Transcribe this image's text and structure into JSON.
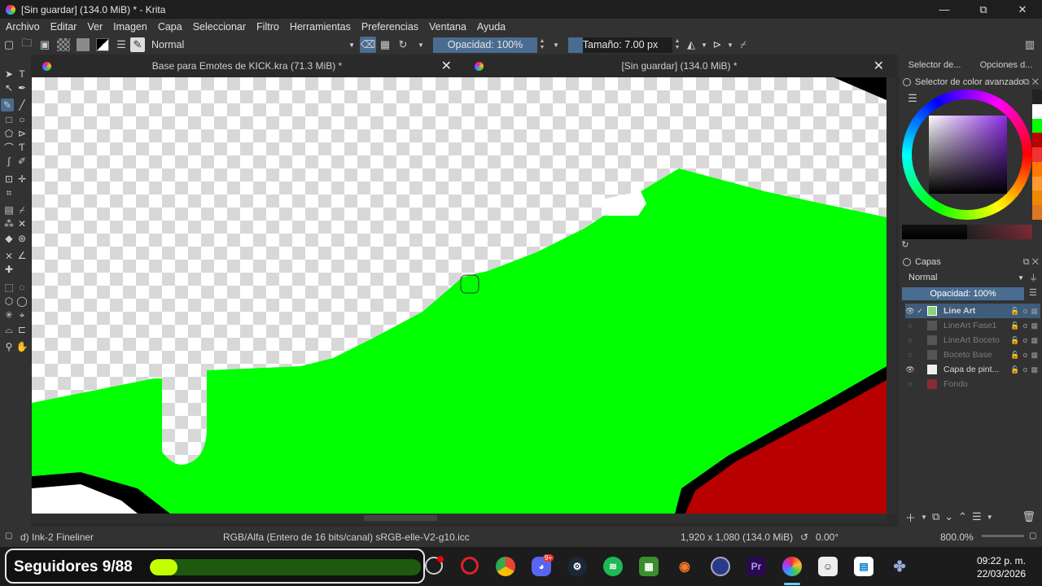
{
  "window": {
    "title": "[Sin guardar]  (134.0 MiB) * - Krita",
    "minimize": "—",
    "maximize": "⧉",
    "close": "✕"
  },
  "menu": [
    "Archivo",
    "Editar",
    "Ver",
    "Imagen",
    "Capa",
    "Seleccionar",
    "Filtro",
    "Herramientas",
    "Preferencias",
    "Ventana",
    "Ayuda"
  ],
  "toolbar": {
    "blend_mode": "Normal",
    "opacity": "Opacidad: 100%",
    "opacity_value": 100,
    "size": "Tamaño: 7.00 px"
  },
  "documents": [
    {
      "title": "Base para Emotes de KICK.kra (71.3 MiB) *",
      "close": "✕"
    },
    {
      "title": "[Sin guardar]  (134.0 MiB) *",
      "close": "✕"
    }
  ],
  "dock": {
    "tab_selector": "Selector de...",
    "tab_options": "Opciones d...",
    "color_panel_title": "Selector de color avanzado",
    "layers_title": "Capas",
    "layer_blend": "Normal",
    "layer_opacity": "Opacidad: 100%",
    "layers": [
      {
        "name": "Line Art",
        "visible": true,
        "selected": true
      },
      {
        "name": "LineArt Fase1",
        "visible": false,
        "selected": false
      },
      {
        "name": "LineArt Boceto",
        "visible": false,
        "selected": false
      },
      {
        "name": "Boceto Base",
        "visible": false,
        "selected": false
      },
      {
        "name": "Capa de pint...",
        "visible": true,
        "selected": false
      },
      {
        "name": "Fondo",
        "visible": false,
        "selected": false
      }
    ]
  },
  "status": {
    "brush": "d) Ink-2 Fineliner",
    "colorspace": "RGB/Alfa (Entero de 16 bits/canal)  sRGB-elle-V2-g10.icc",
    "dimensions": "1,920 x 1,080 (134.0 MiB)",
    "rotation": "0.00°",
    "zoom": "800.0%"
  },
  "taskbar": {
    "followers_label": "Seguidores 9/88",
    "followers_progress": 0.102,
    "discord_badge": "9+",
    "time": "09:22 p. m.",
    "date": "22/03/2026"
  },
  "colors": {
    "accent": "#4a6c91",
    "fill_green": "#00ff00",
    "fill_red": "#b80000",
    "progress": "#c4ff00"
  }
}
